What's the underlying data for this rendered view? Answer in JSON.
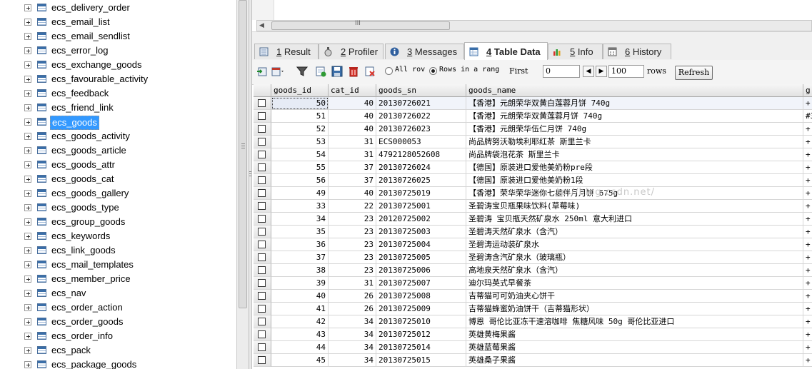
{
  "tree": {
    "items": [
      "ecs_delivery_order",
      "ecs_email_list",
      "ecs_email_sendlist",
      "ecs_error_log",
      "ecs_exchange_goods",
      "ecs_favourable_activity",
      "ecs_feedback",
      "ecs_friend_link",
      "ecs_goods",
      "ecs_goods_activity",
      "ecs_goods_article",
      "ecs_goods_attr",
      "ecs_goods_cat",
      "ecs_goods_gallery",
      "ecs_goods_type",
      "ecs_group_goods",
      "ecs_keywords",
      "ecs_link_goods",
      "ecs_mail_templates",
      "ecs_member_price",
      "ecs_nav",
      "ecs_order_action",
      "ecs_order_goods",
      "ecs_order_info",
      "ecs_pack",
      "ecs_package_goods"
    ],
    "selected": "ecs_goods"
  },
  "hscroll": {
    "grip": "III"
  },
  "tabs": [
    {
      "num": "1",
      "label": "Result",
      "icon": "result-icon"
    },
    {
      "num": "2",
      "label": "Profiler",
      "icon": "profiler-icon"
    },
    {
      "num": "3",
      "label": "Messages",
      "icon": "messages-icon"
    },
    {
      "num": "4",
      "label": "Table Data",
      "icon": "table-data-icon",
      "active": true
    },
    {
      "num": "5",
      "label": "Info",
      "icon": "info-icon"
    },
    {
      "num": "6",
      "label": "History",
      "icon": "history-icon"
    }
  ],
  "toolbar": {
    "radio_all": "All rov",
    "radio_range": "Rows in a rang",
    "first_label": "First",
    "first_value": "0",
    "prev_glyph": "◀",
    "next_glyph": "▶",
    "count_value": "100",
    "rows_label": "rows",
    "refresh_label": "Refresh"
  },
  "grid": {
    "columns": [
      "goods_id",
      "cat_id",
      "goods_sn",
      "goods_name",
      "g"
    ],
    "rows": [
      [
        "50",
        "40",
        "20130726021",
        "【香港】元朗荣华双黄白莲蓉月饼 740g",
        "+"
      ],
      [
        "51",
        "40",
        "20130726022",
        "【香港】元朗荣华双黄莲蓉月饼 740g",
        "#3"
      ],
      [
        "52",
        "40",
        "20130726023",
        "【香港】元朗荣华伍仁月饼 740g",
        "+"
      ],
      [
        "53",
        "31",
        "ECS000053",
        "尚品牌努沃勒埃利耶红茶  斯里兰卡",
        "+"
      ],
      [
        "54",
        "31",
        "4792128052608",
        "尚品牌袋泡花茶  斯里兰卡",
        "+"
      ],
      [
        "55",
        "37",
        "20130726024",
        "【德国】原装进口爱他美奶粉pre段",
        "+"
      ],
      [
        "56",
        "37",
        "20130726025",
        "【德国】原装进口爱他美奶粉1段",
        "+"
      ],
      [
        "49",
        "40",
        "20130725019",
        "【香港】荣华荣华迷你七星伴月月饼 675g",
        "+"
      ],
      [
        "33",
        "22",
        "20130725001",
        "圣碧涛宝贝瓶果味饮料(草莓味)",
        "+"
      ],
      [
        "34",
        "23",
        "20120725002",
        "圣碧涛 宝贝瓶天然矿泉水 250ml 意大利进口",
        "+"
      ],
      [
        "35",
        "23",
        "20130725003",
        "圣碧涛天然矿泉水（含汽）",
        "+"
      ],
      [
        "36",
        "23",
        "20130725004",
        "圣碧涛运动装矿泉水",
        "+"
      ],
      [
        "37",
        "23",
        "20130725005",
        "圣碧涛含汽矿泉水（玻璃瓶）",
        "+"
      ],
      [
        "38",
        "23",
        "20130725006",
        "高地泉天然矿泉水（含汽）",
        "+"
      ],
      [
        "39",
        "31",
        "20130725007",
        "迪尔玛英式早餐茶",
        "+"
      ],
      [
        "40",
        "26",
        "20130725008",
        "吉蒂猫可可奶油夹心饼干",
        "+"
      ],
      [
        "41",
        "26",
        "20130725009",
        "吉蒂猫蜂蜜奶油饼干（吉蒂猫形状）",
        "+"
      ],
      [
        "42",
        "34",
        "20130725010",
        "博恩 哥伦比亚冻干速溶咖啡 焦糖风味 50g 哥伦比亚进口",
        "+"
      ],
      [
        "43",
        "34",
        "20130725012",
        "英雄黄梅果酱",
        "+"
      ],
      [
        "44",
        "34",
        "20130725014",
        "英雄蓝莓果酱",
        "+"
      ],
      [
        "45",
        "34",
        "20130725015",
        "英雄桑子果酱",
        "+"
      ]
    ]
  },
  "watermark": "tp://blog.csdn.net/"
}
